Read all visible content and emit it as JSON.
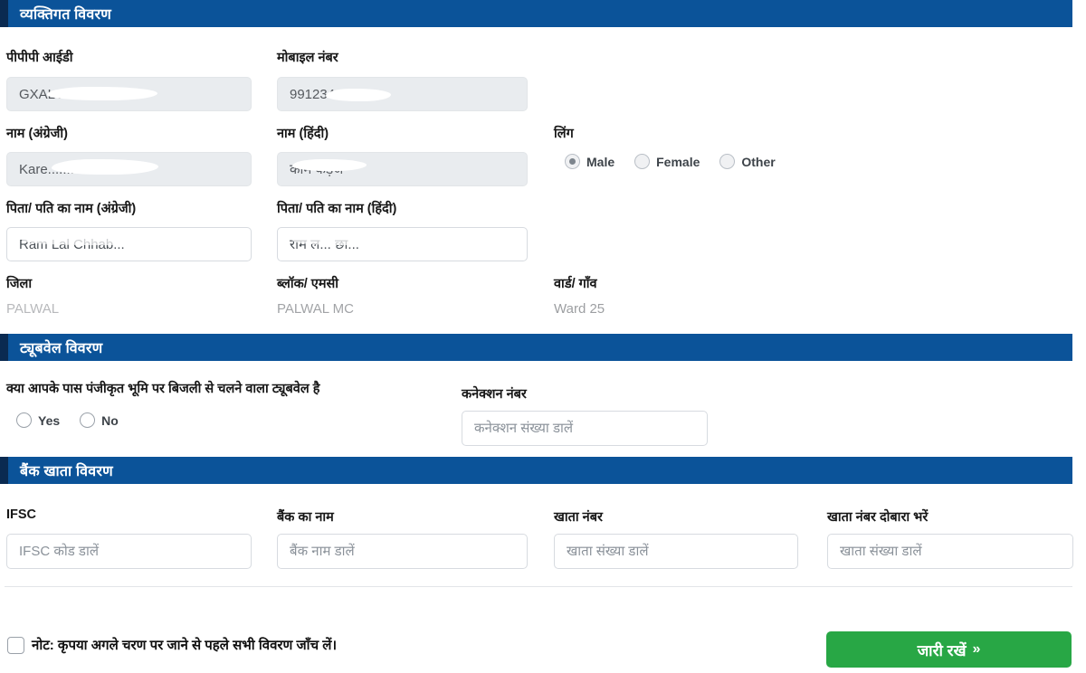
{
  "colors": {
    "header_blue": "#0b5399",
    "header_accent_navy": "#0a2a51",
    "continue_green": "#28a745",
    "disabled_grey": "#e9ecef"
  },
  "sections": {
    "personal": {
      "title": "व्यक्तिगत विवरण",
      "fields": {
        "ppp_id": {
          "label": "पीपीपी आईडी",
          "value": "GXALC4105"
        },
        "mobile": {
          "label": "मोबाइल नंबर",
          "value": "991234...."
        },
        "name_en": {
          "label": "नाम (अंग्रेजी)",
          "value": "Kare......."
        },
        "name_hi": {
          "label": "नाम (हिंदी)",
          "value": "काम कड़ज"
        },
        "father_name_en": {
          "label": "पिता/ पति का नाम (अंग्रेजी)",
          "value": "Ram Lal Chhab..."
        },
        "father_name_hi": {
          "label": "पिता/ पति का नाम (हिंदी)",
          "value": "राम ल... छा..."
        },
        "district": {
          "label": "जिला",
          "value": "PALWAL"
        },
        "block_mc": {
          "label": "ब्लॉक/ एमसी",
          "value": "PALWAL MC"
        },
        "ward_village": {
          "label": "वार्ड/ गाँव",
          "value": "Ward 25"
        }
      },
      "gender": {
        "label": "लिंग",
        "options": [
          {
            "label": "Male",
            "selected": true
          },
          {
            "label": "Female",
            "selected": false
          },
          {
            "label": "Other",
            "selected": false
          }
        ]
      }
    },
    "tubewell": {
      "title": "ट्यूबवेल विवरण",
      "question": "क्या आपके पास पंजीकृत भूमि पर बिजली से चलने वाला ट्यूबवेल है",
      "options": [
        {
          "label": "Yes",
          "selected": false
        },
        {
          "label": "No",
          "selected": false
        }
      ],
      "connection": {
        "label": "कनेक्शन नंबर",
        "placeholder": "कनेक्शन संख्या डालें",
        "value": ""
      }
    },
    "bank": {
      "title": "बैंक खाता विवरण",
      "fields": {
        "ifsc": {
          "label": "IFSC",
          "placeholder": "IFSC कोड डालें",
          "value": ""
        },
        "bank_name": {
          "label": "बैंक का नाम",
          "placeholder": "बैंक नाम डालें",
          "value": ""
        },
        "account_no": {
          "label": "खाता नंबर",
          "placeholder": "खाता संख्या डालें",
          "value": ""
        },
        "account_no_confirm": {
          "label": "खाता नंबर दोबारा भरें",
          "placeholder": "खाता संख्या डालें",
          "value": ""
        }
      }
    }
  },
  "footer": {
    "note": "नोट: कृपया अगले चरण पर जाने से पहले सभी विवरण जाँच लें।",
    "checked": false,
    "continue_label": "जारी रखें",
    "continue_chevron": "»"
  }
}
